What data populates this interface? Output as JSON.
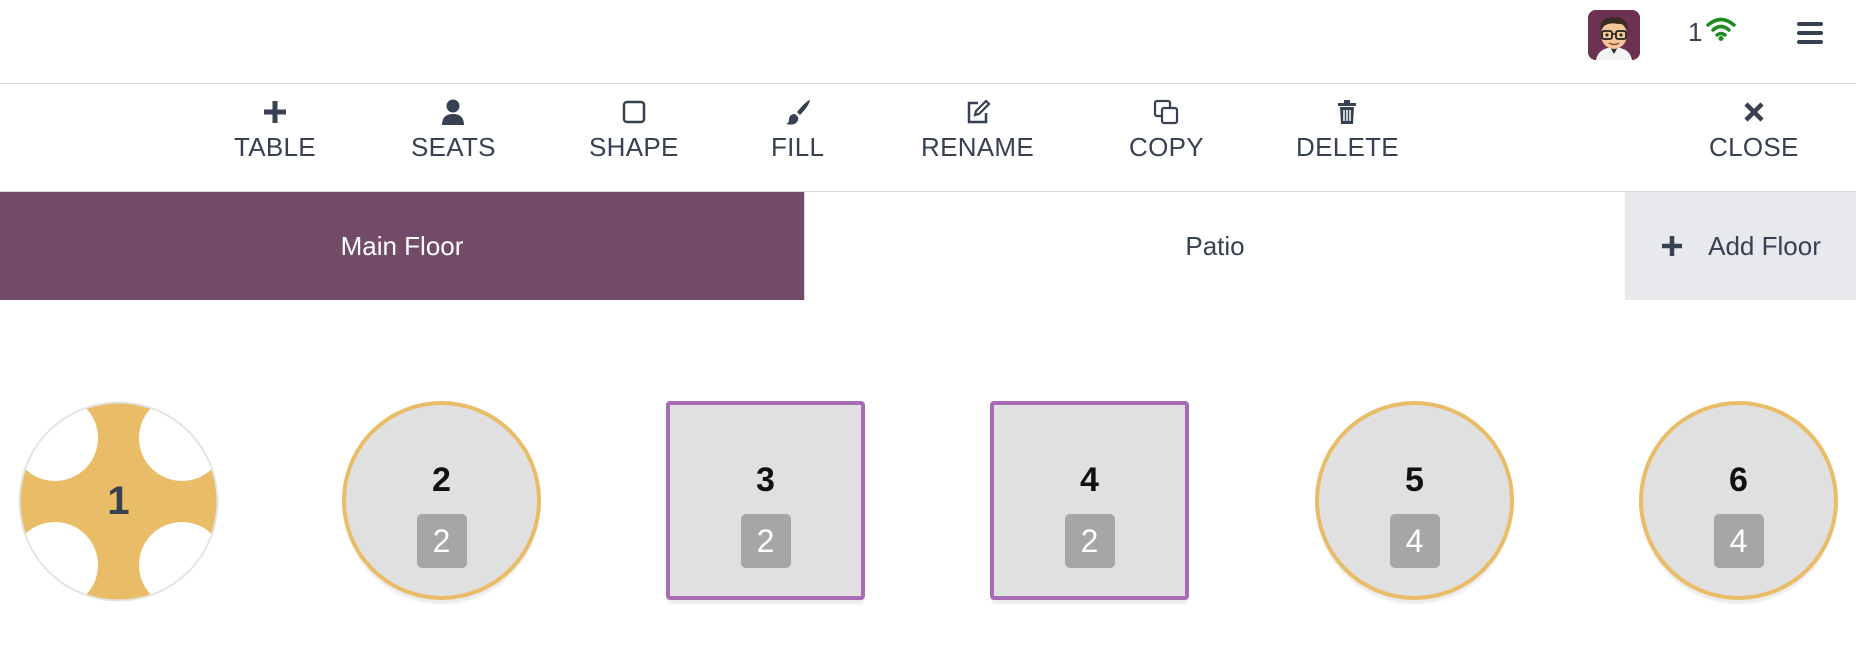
{
  "navbar": {
    "avatar_icon": "user-avatar-icon",
    "connection_count": "1",
    "connection_icon": "wifi-icon",
    "connection_color": "#1f8a1f",
    "menu_icon": "hamburger-menu-icon"
  },
  "toolbar": {
    "table_label": "TABLE",
    "seats_label": "SEATS",
    "shape_label": "SHAPE",
    "fill_label": "FILL",
    "rename_label": "RENAME",
    "copy_label": "COPY",
    "delete_label": "DELETE",
    "close_label": "CLOSE"
  },
  "floors": {
    "active_color": "#714b67",
    "items": [
      {
        "label": "Main Floor",
        "active": true
      },
      {
        "label": "Patio",
        "active": false
      }
    ],
    "add_label": "Add Floor"
  },
  "tables": [
    {
      "number": "1",
      "shape": "round",
      "selected": true,
      "fill": "#e9bd67"
    },
    {
      "number": "2",
      "shape": "round",
      "seats": "2"
    },
    {
      "number": "3",
      "shape": "square",
      "seats": "2"
    },
    {
      "number": "4",
      "shape": "square",
      "seats": "2"
    },
    {
      "number": "5",
      "shape": "round",
      "seats": "4"
    },
    {
      "number": "6",
      "shape": "round",
      "seats": "4"
    }
  ]
}
